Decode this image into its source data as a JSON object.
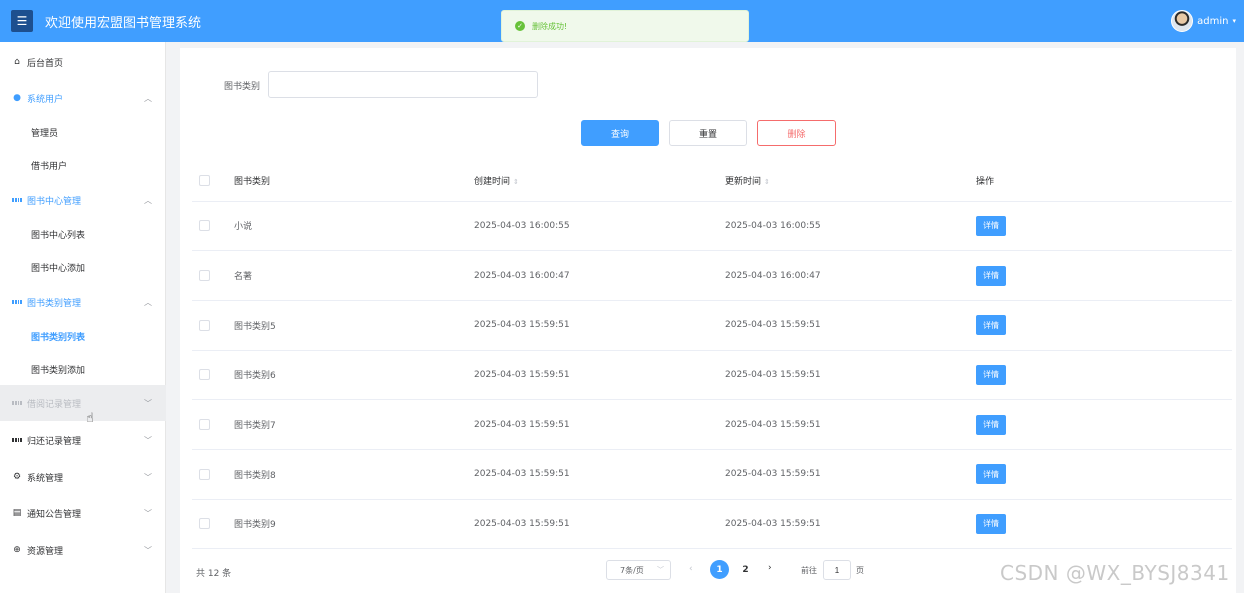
{
  "header": {
    "title": "欢迎使用宏盟图书管理系统",
    "username": "admin"
  },
  "toast": {
    "message": "删除成功!"
  },
  "sidebar": {
    "items": [
      {
        "label": "后台首页"
      },
      {
        "label": "系统用户"
      },
      {
        "label": "管理员"
      },
      {
        "label": "借书用户"
      },
      {
        "label": "图书中心管理"
      },
      {
        "label": "图书中心列表"
      },
      {
        "label": "图书中心添加"
      },
      {
        "label": "图书类别管理"
      },
      {
        "label": "图书类别列表"
      },
      {
        "label": "图书类别添加"
      },
      {
        "label": "借阅记录管理"
      },
      {
        "label": "归还记录管理"
      },
      {
        "label": "系统管理"
      },
      {
        "label": "通知公告管理"
      },
      {
        "label": "资源管理"
      }
    ]
  },
  "search": {
    "label": "图书类别",
    "value": ""
  },
  "buttons": {
    "query": "查询",
    "reset": "重置",
    "delete": "删除"
  },
  "table": {
    "headers": {
      "category": "图书类别",
      "created": "创建时间",
      "updated": "更新时间",
      "actions": "操作"
    },
    "detail_label": "详情",
    "rows": [
      {
        "category": "小说",
        "created": "2025-04-03 16:00:55",
        "updated": "2025-04-03 16:00:55"
      },
      {
        "category": "名著",
        "created": "2025-04-03 16:00:47",
        "updated": "2025-04-03 16:00:47"
      },
      {
        "category": "图书类别5",
        "created": "2025-04-03 15:59:51",
        "updated": "2025-04-03 15:59:51"
      },
      {
        "category": "图书类别6",
        "created": "2025-04-03 15:59:51",
        "updated": "2025-04-03 15:59:51"
      },
      {
        "category": "图书类别7",
        "created": "2025-04-03 15:59:51",
        "updated": "2025-04-03 15:59:51"
      },
      {
        "category": "图书类别8",
        "created": "2025-04-03 15:59:51",
        "updated": "2025-04-03 15:59:51"
      },
      {
        "category": "图书类别9",
        "created": "2025-04-03 15:59:51",
        "updated": "2025-04-03 15:59:51"
      }
    ]
  },
  "pagination": {
    "total_text": "共 12 条",
    "page_size": "7条/页",
    "pages": [
      "1",
      "2"
    ],
    "goto_label": "前往",
    "goto_value": "1",
    "goto_suffix": "页"
  },
  "watermark": "CSDN @WX_BYSJ8341",
  "colors": {
    "primary": "#409eff",
    "success": "#67c23a",
    "danger": "#f56c6c"
  }
}
